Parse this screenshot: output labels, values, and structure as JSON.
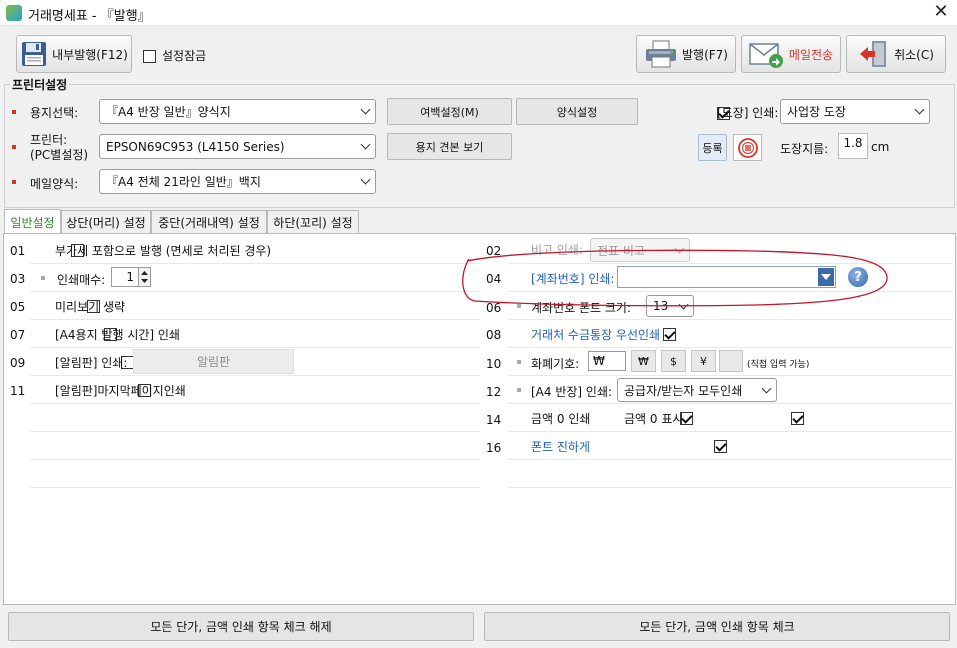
{
  "window": {
    "title": "거래명세표 - 『발행』",
    "close": "✕"
  },
  "toolbar": {
    "internal_issue": "내부발행(F12)",
    "settings_lock": "설정잠금",
    "issue": "발행(F7)",
    "email_send": "메일전송",
    "cancel": "취소(C)"
  },
  "printer_settings": {
    "title": "프린터설정",
    "paper_label": "용지선택:",
    "paper_value": "『A4 반장 일반』양식지",
    "printer_label_1": "프린터:",
    "printer_label_2": "(PC별설정)",
    "printer_value": "EPSON69C953 (L4150 Series)",
    "mail_form_label": "메일양식:",
    "mail_form_value": "『A4 전체 21라인 일반』백지",
    "margin_button": "여백설정(M)",
    "form_button": "양식설정",
    "sample_button": "용지 견본 보기",
    "stamp_label": "[도장] 인쇄:",
    "stamp_value": "사업장 도장",
    "register_button": "등록",
    "stamp_size_label": "도장지름:",
    "stamp_size_value": "1.8",
    "stamp_size_unit": "cm"
  },
  "tabs": [
    {
      "label": "일반설정"
    },
    {
      "label": "상단(머리) 설정"
    },
    {
      "label": "중단(거래내역) 설정"
    },
    {
      "label": "하단(꼬리) 설정"
    }
  ],
  "general": {
    "left": [
      {
        "num": "01",
        "label": "부가세 포함으로 발행 (면세로 처리된 경우)"
      },
      {
        "num": "03",
        "label": "인쇄매수:",
        "value": "1"
      },
      {
        "num": "05",
        "label": "미리보기 생략"
      },
      {
        "num": "07",
        "label": "[A4용지 발행 시간] 인쇄"
      },
      {
        "num": "09",
        "label": "[알림판] 인쇄:",
        "button": "알림판"
      },
      {
        "num": "11",
        "label": "[알림판]마지막페이지인쇄"
      }
    ],
    "right": [
      {
        "num": "02",
        "label": "비고 인쇄:",
        "select": "전표 비고"
      },
      {
        "num": "04",
        "label": "[계좌번호] 인쇄:",
        "select": ""
      },
      {
        "num": "06",
        "label": "계좌번호 폰트 크기:",
        "select": "13"
      },
      {
        "num": "08",
        "label": "거래처 수금통장 우선인쇄"
      },
      {
        "num": "10",
        "label": "화폐기호:",
        "value": "₩",
        "symbols": [
          "₩",
          "$",
          "¥",
          ""
        ],
        "note": "(직접 입력 가능)"
      },
      {
        "num": "12",
        "label": "[A4 반장] 인쇄:",
        "select": "공급자/받는자 모두인쇄"
      },
      {
        "num": "14",
        "label": "금액 0 인쇄",
        "label2": "금액 0 표시"
      },
      {
        "num": "16",
        "label": "폰트 진하게"
      }
    ]
  },
  "bottom": {
    "uncheck_all": "모든 단가, 금액 인쇄 항목 체크 해제",
    "check_all": "모든 단가, 금액 인쇄 항목 체크"
  },
  "colors": {
    "accent_red": "#d9342b",
    "active_tab_green": "#2f8a2f",
    "link_blue": "#1f5fbf",
    "annotation_red": "#c0182a"
  }
}
